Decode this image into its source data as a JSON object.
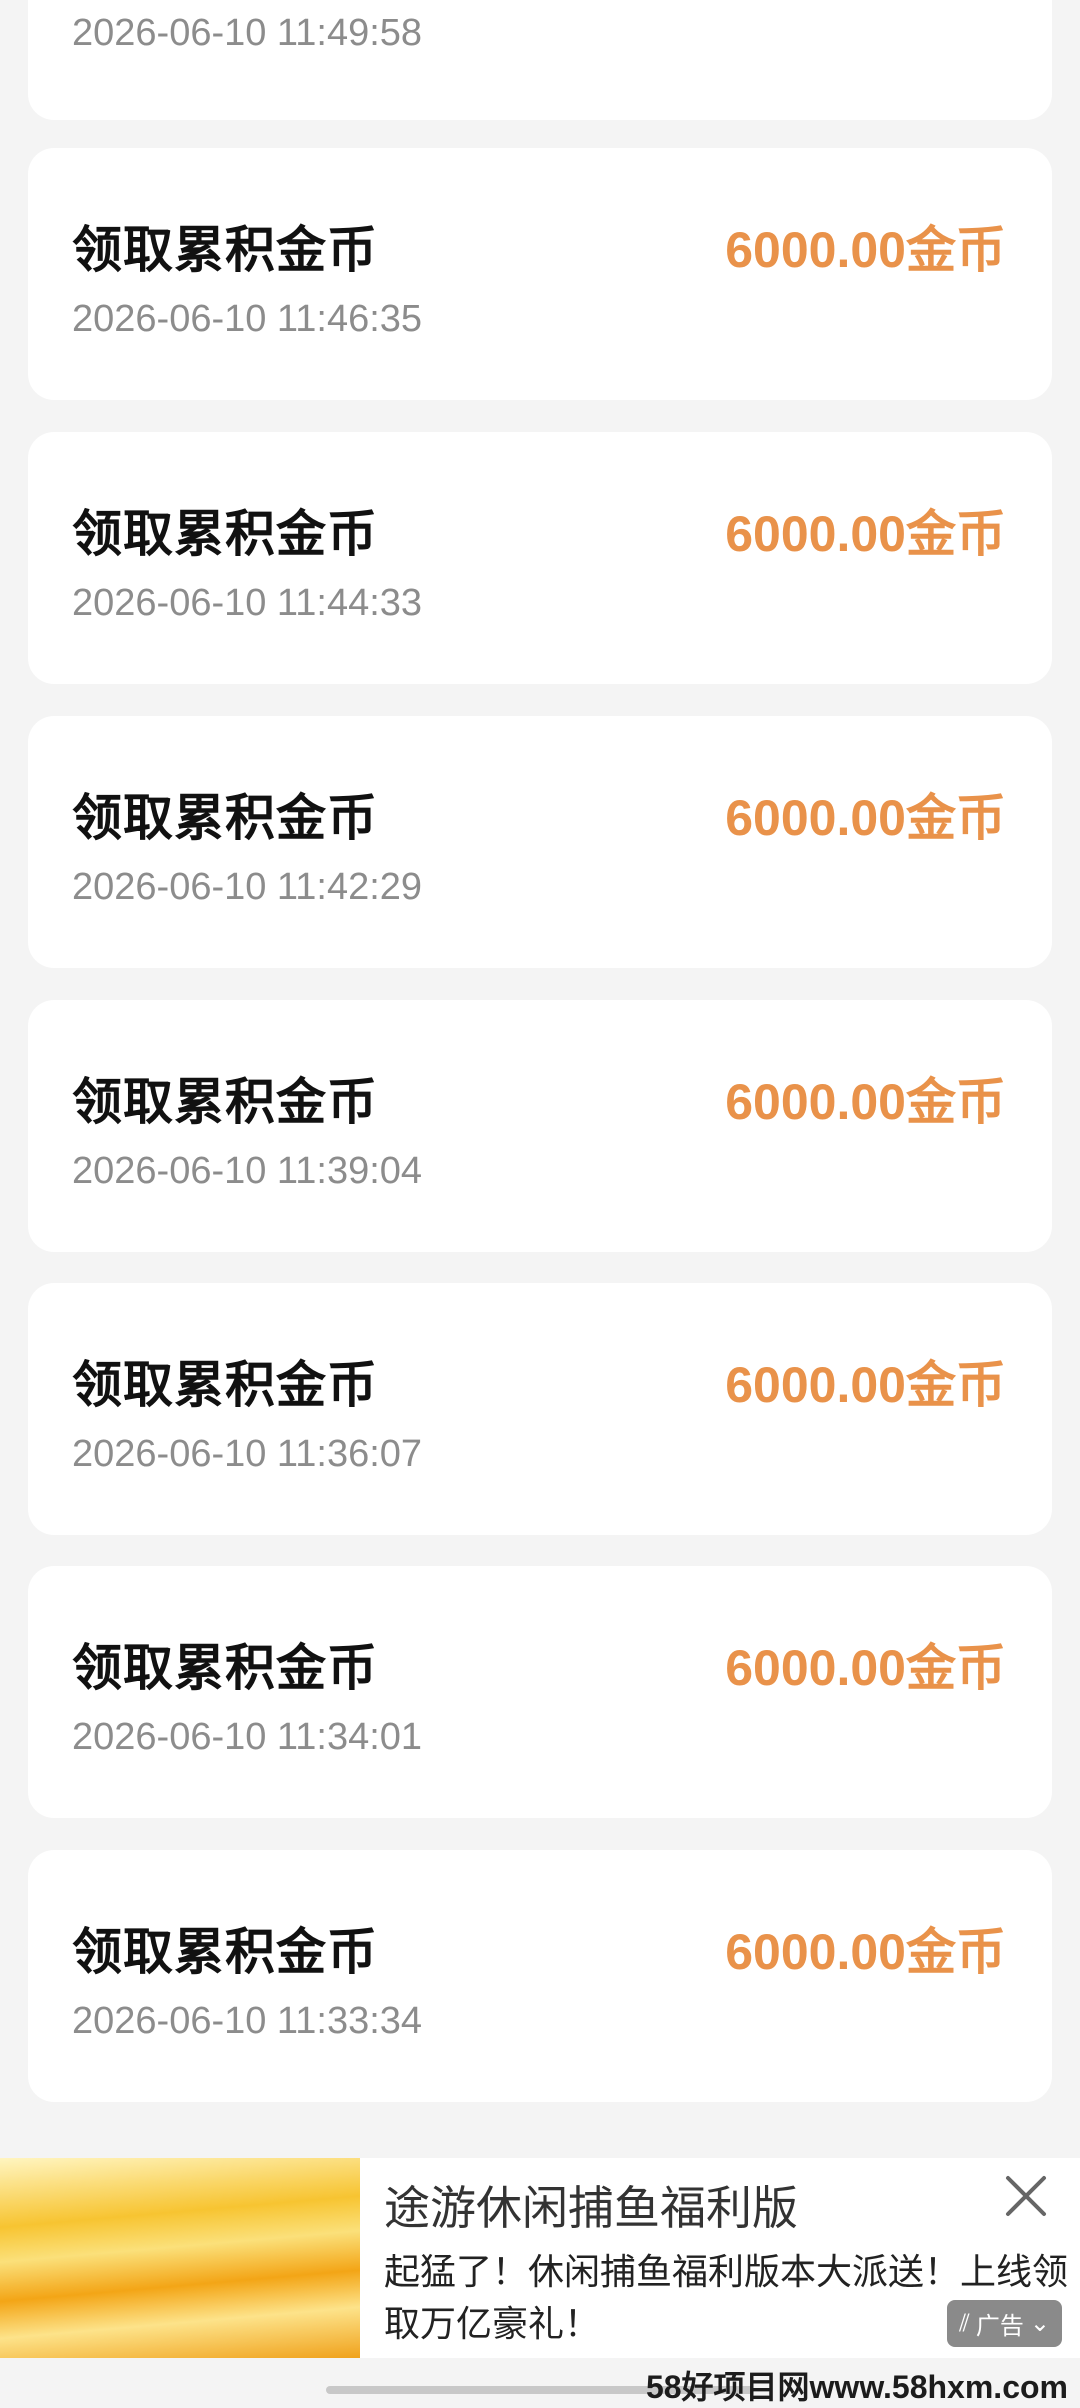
{
  "top_card": {
    "time": "2026-06-10 11:49:58"
  },
  "records": [
    {
      "title": "领取累积金币",
      "amount": "6000.00金币",
      "time": "2026-06-10 11:46:35"
    },
    {
      "title": "领取累积金币",
      "amount": "6000.00金币",
      "time": "2026-06-10 11:44:33"
    },
    {
      "title": "领取累积金币",
      "amount": "6000.00金币",
      "time": "2026-06-10 11:42:29"
    },
    {
      "title": "领取累积金币",
      "amount": "6000.00金币",
      "time": "2026-06-10 11:39:04"
    },
    {
      "title": "领取累积金币",
      "amount": "6000.00金币",
      "time": "2026-06-10 11:36:07"
    },
    {
      "title": "领取累积金币",
      "amount": "6000.00金币",
      "time": "2026-06-10 11:34:01"
    },
    {
      "title": "领取累积金币",
      "amount": "6000.00金币",
      "time": "2026-06-10 11:33:34"
    }
  ],
  "ad": {
    "title": "途游休闲捕鱼福利版",
    "description": "起猛了！休闲捕鱼福利版本大派送！上线领取万亿豪礼！",
    "badge_label": "广告"
  },
  "watermark": "58好项目网www.58hxm.com",
  "colors": {
    "amount": "#e9924a",
    "background": "#f4f4f4",
    "card": "#ffffff"
  }
}
